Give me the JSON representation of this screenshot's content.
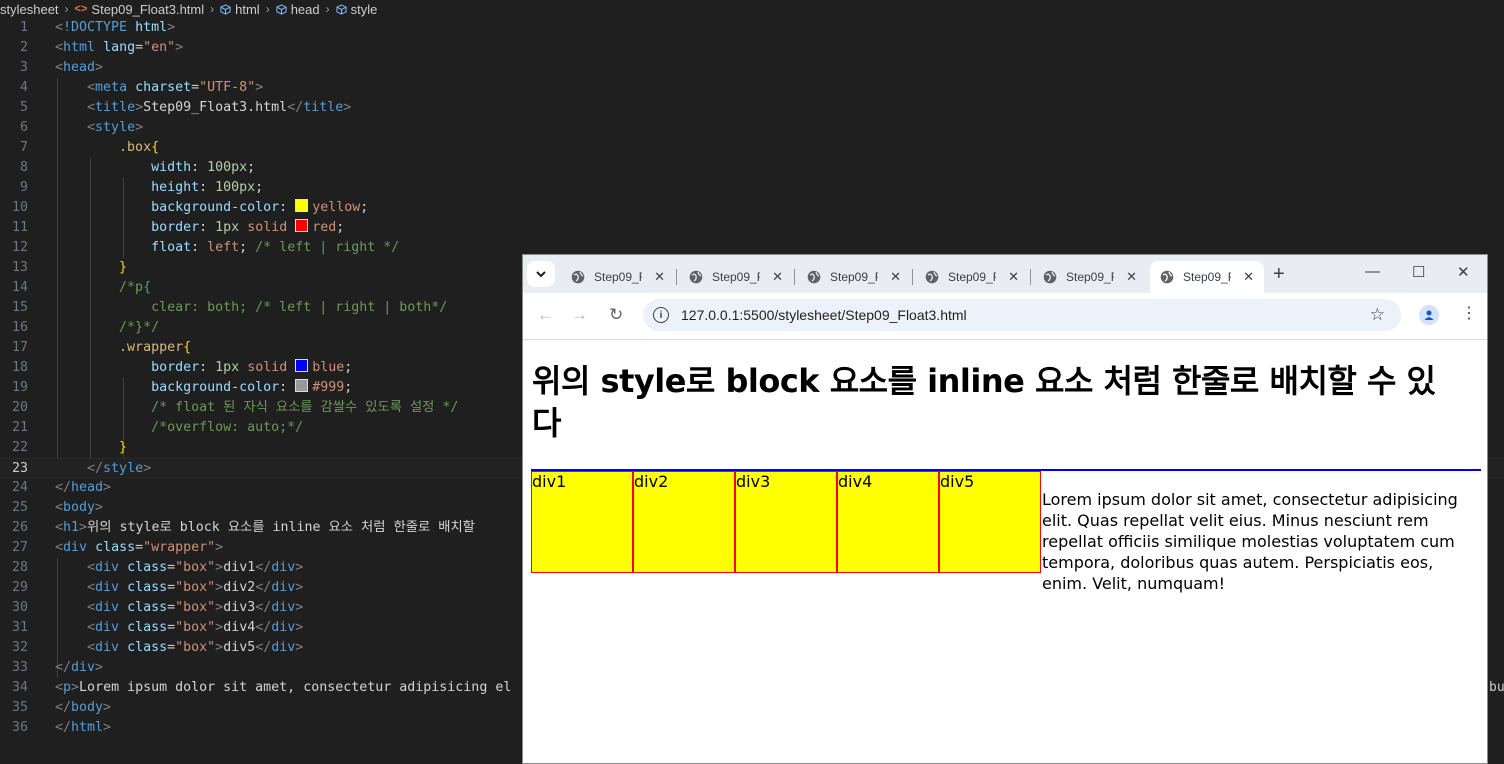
{
  "breadcrumb": {
    "items": [
      "stylesheet",
      "Step09_Float3.html",
      "html",
      "head",
      "style"
    ]
  },
  "editor": {
    "lines": [
      {
        "n": "1"
      },
      {
        "n": "2"
      },
      {
        "n": "3"
      },
      {
        "n": "4"
      },
      {
        "n": "5"
      },
      {
        "n": "6"
      },
      {
        "n": "7"
      },
      {
        "n": "8"
      },
      {
        "n": "9"
      },
      {
        "n": "10"
      },
      {
        "n": "11"
      },
      {
        "n": "12"
      },
      {
        "n": "13"
      },
      {
        "n": "14"
      },
      {
        "n": "15"
      },
      {
        "n": "16"
      },
      {
        "n": "17"
      },
      {
        "n": "18"
      },
      {
        "n": "19"
      },
      {
        "n": "20"
      },
      {
        "n": "21"
      },
      {
        "n": "22"
      },
      {
        "n": "23"
      },
      {
        "n": "24"
      },
      {
        "n": "25"
      },
      {
        "n": "26"
      },
      {
        "n": "27"
      },
      {
        "n": "28"
      },
      {
        "n": "29"
      },
      {
        "n": "30"
      },
      {
        "n": "31"
      },
      {
        "n": "32"
      },
      {
        "n": "33"
      },
      {
        "n": "34"
      },
      {
        "n": "35"
      },
      {
        "n": "36"
      }
    ],
    "code": {
      "doctype": "!DOCTYPE",
      "html_kw": "html",
      "lang_attr": "lang",
      "lang_val": "\"en\"",
      "head": "head",
      "meta": "meta",
      "charset": "charset",
      "charset_val": "\"UTF-8\"",
      "title": "title",
      "title_text": "Step09_Float3.html",
      "style": "style",
      "box_sel": ".box",
      "width": "width",
      "w_val": "100px",
      "height": "height",
      "h_val": "100px",
      "bgc": "background-color",
      "yellow": "yellow",
      "border": "border",
      "px1": "1px",
      "solid": "solid",
      "red": "red",
      "float": "float",
      "left": "left",
      "float_comment": "/* left | right */",
      "p_open_comment": "/*p{",
      "clear_comment": "clear: both; /* left | right | both*/",
      "close_comment": "/*}*/",
      "wrapper_sel": ".wrapper",
      "blue": "blue",
      "grey": "#999",
      "float_note": "/* float 된 자식 요소를 감쌀수 있도록 설정 */",
      "overflow_note": "/*overflow: auto;*/",
      "body": "body",
      "h1": "h1",
      "h1_text": "위의 style로 block 요소를 inline 요소 처럼 한줄로 배치할",
      "div": "div",
      "class": "class",
      "wrapper_val": "\"wrapper\"",
      "box_val": "\"box\"",
      "div1": "div1",
      "div2": "div2",
      "div3": "div3",
      "div4": "div4",
      "div5": "div5",
      "p": "p",
      "p_text": "Lorem ipsum dolor sit amet, consectetur adipisicing el",
      "overflow_tail": "bu"
    },
    "colors": {
      "yellow": "#ffff00",
      "red": "#ff0000",
      "blue": "#0000ff",
      "grey": "#999999"
    }
  },
  "browser": {
    "tabs": [
      {
        "label": "Step09_F"
      },
      {
        "label": "Step09_F"
      },
      {
        "label": "Step09_F"
      },
      {
        "label": "Step09_F"
      },
      {
        "label": "Step09_F"
      },
      {
        "label": "Step09_F"
      }
    ],
    "url": "127.0.0.1:5500/stylesheet/Step09_Float3.html",
    "page": {
      "h1": "위의 style로 block 요소를 inline 요소 처럼 한줄로 배치할 수 있다",
      "boxes": [
        "div1",
        "div2",
        "div3",
        "div4",
        "div5"
      ],
      "paragraph": "Lorem ipsum dolor sit amet, consectetur adipisicing elit. Quas repellat velit eius. Minus nesciunt rem repellat officiis similique molestias voluptatem cum tempora, doloribus quas autem. Perspiciatis eos, enim. Velit, numquam!"
    }
  }
}
